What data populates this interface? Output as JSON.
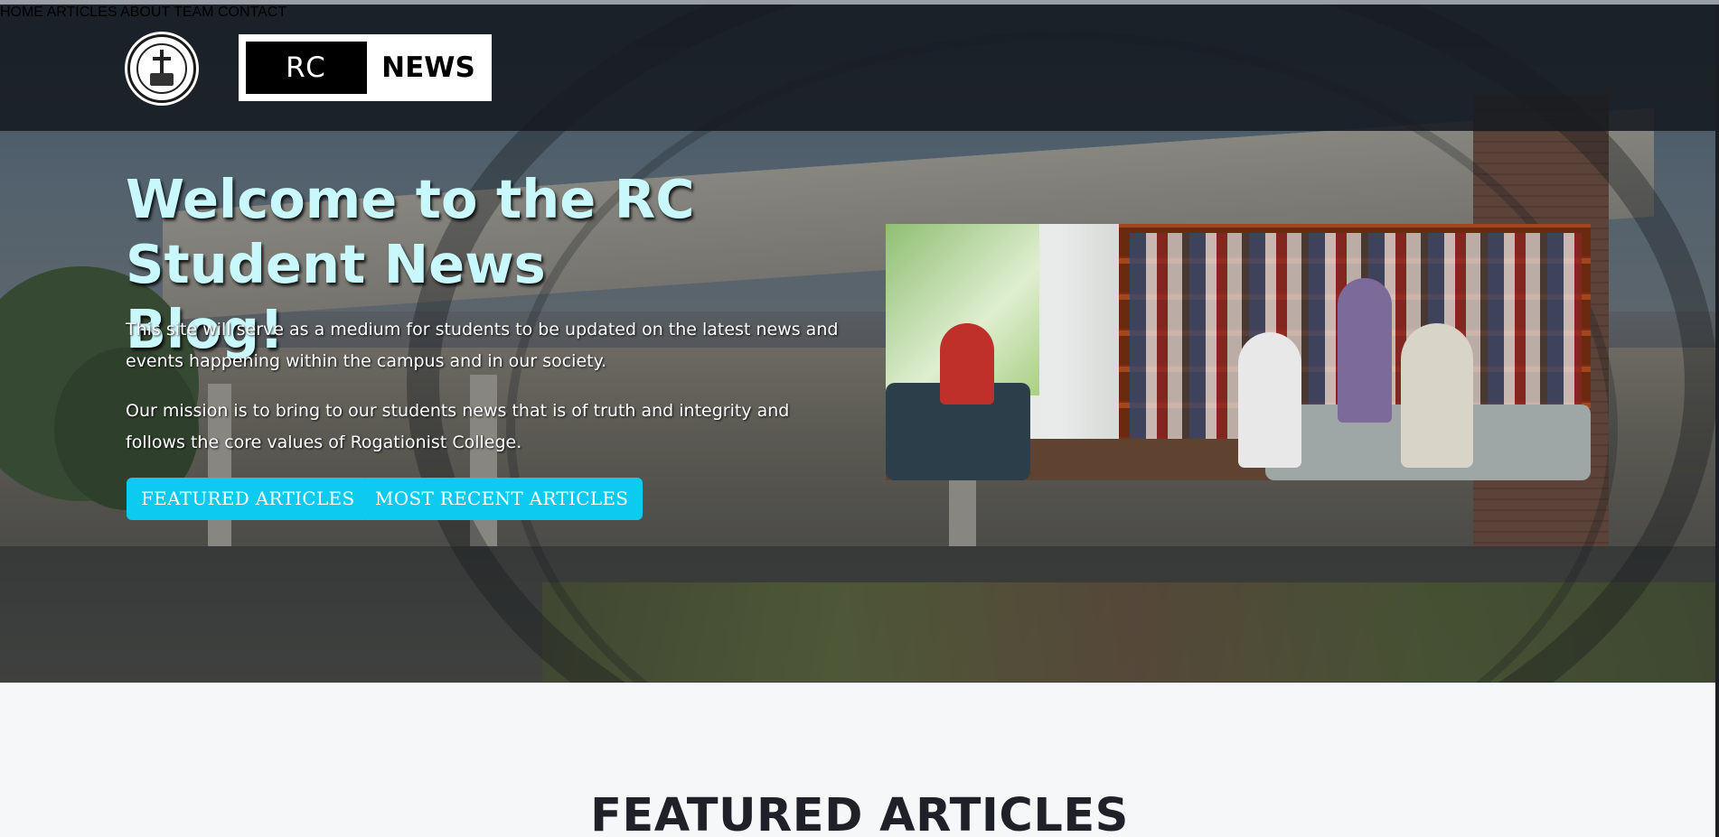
{
  "brand": {
    "rc": "RC",
    "news": "NEWS"
  },
  "nav": {
    "items": [
      {
        "label": "HOME"
      },
      {
        "label": "ARTICLES"
      },
      {
        "label": "ABOUT"
      },
      {
        "label": "TEAM"
      },
      {
        "label": "CONTACT"
      }
    ]
  },
  "hero": {
    "title": "Welcome to the RC Student News Blog!",
    "paragraph1": "This site will serve as a medium for students to be updated on the latest news and events happening within the campus and in our society.",
    "paragraph2": "Our mission is to bring to our students news that is of truth and integrity and follows the core values of Rogationist College.",
    "buttons": {
      "featured": "FEATURED ARTICLES",
      "recent": "MOST RECENT ARTICLES"
    }
  },
  "featured": {
    "heading": "FEATURED ARTICLES"
  },
  "colors": {
    "accent": "#0dcaf0",
    "title": "#c8f8fb",
    "navbar": "#161a20",
    "section_bg": "#f6f7f9"
  },
  "icons": {
    "school_seal": "school-seal-logo",
    "brand_logo": "rc-news-logo"
  }
}
